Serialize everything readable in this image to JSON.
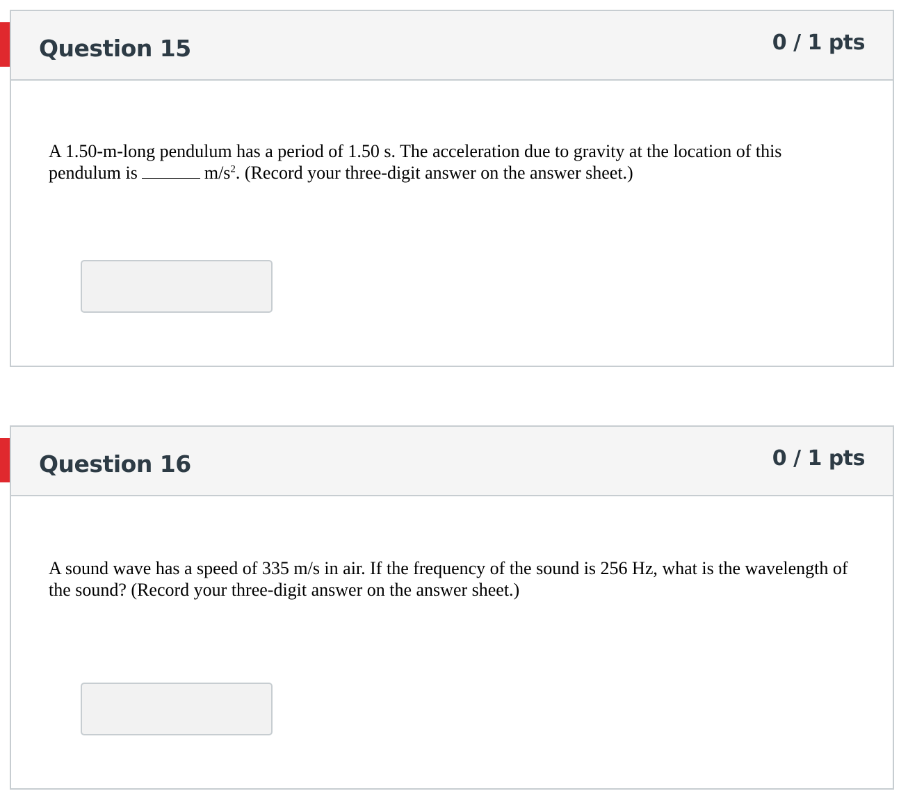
{
  "questions": [
    {
      "title": "Question 15",
      "points": "0 / 1 pts",
      "text_before": "A 1.50-m-long pendulum has a period of 1.50 s. The acceleration due to gravity at the location of this pendulum is",
      "blank": "______",
      "unit": "m/s",
      "unit_sup": "2",
      "text_after": ". (Record your three-digit answer on the answer sheet.)",
      "answer_value": ""
    },
    {
      "title": "Question 16",
      "points": "0 / 1 pts",
      "text": "A sound wave has a speed of 335 m/s in air. If the frequency of the sound is 256 Hz, what is the wavelength of the sound? (Record your three-digit answer on the answer sheet.)",
      "answer_value": ""
    }
  ],
  "colors": {
    "flag": "#e0292e",
    "header_bg": "#f5f5f5",
    "border": "#c7cdd1",
    "title_text": "#2d3b45",
    "input_bg": "#f2f2f2"
  },
  "icons": {
    "incorrect_flag": "flag-icon"
  }
}
